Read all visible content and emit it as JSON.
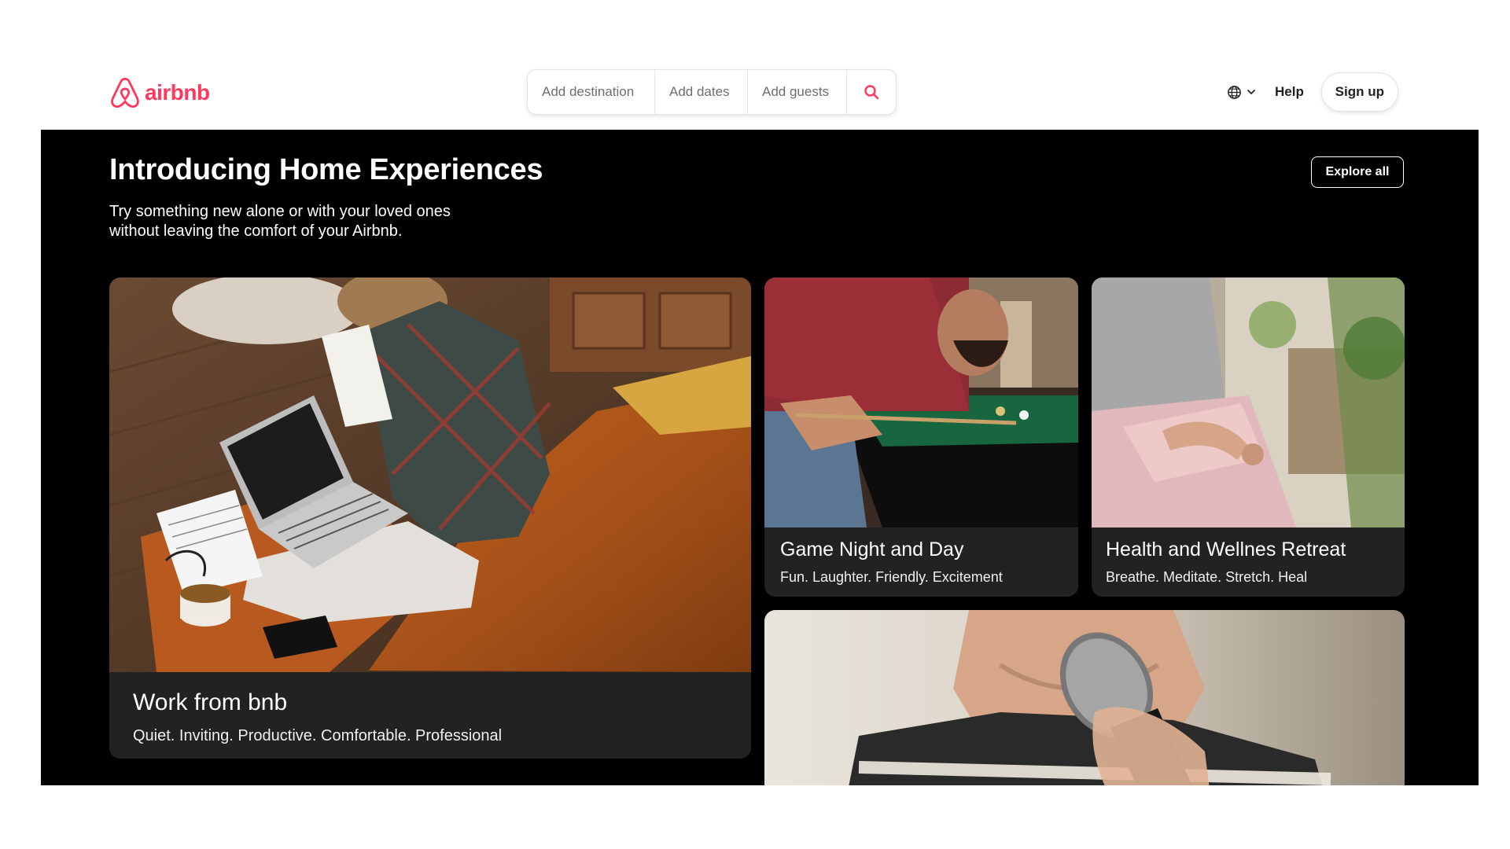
{
  "header": {
    "logo_text": "airbnb",
    "brand_color": "#FF385C",
    "search": {
      "destination": "Add destination",
      "dates": "Add dates",
      "guests": "Add guests"
    },
    "nav": {
      "help": "Help",
      "signup": "Sign up"
    }
  },
  "hero": {
    "title": "Introducing Home Experiences",
    "subtitle_line1": "Try something new alone or with your loved ones",
    "subtitle_line2": "without leaving the comfort of your Airbnb.",
    "explore_label": "Explore all",
    "cards": [
      {
        "title": "Work from bnb",
        "subtitle": "Quiet. Inviting. Productive. Comfortable. Professional"
      },
      {
        "title": "Game Night and Day",
        "subtitle": "Fun. Laughter. Friendly. Excitement"
      },
      {
        "title": "Health and Wellnes Retreat",
        "subtitle": "Breathe. Meditate. Stretch. Heal"
      }
    ]
  }
}
